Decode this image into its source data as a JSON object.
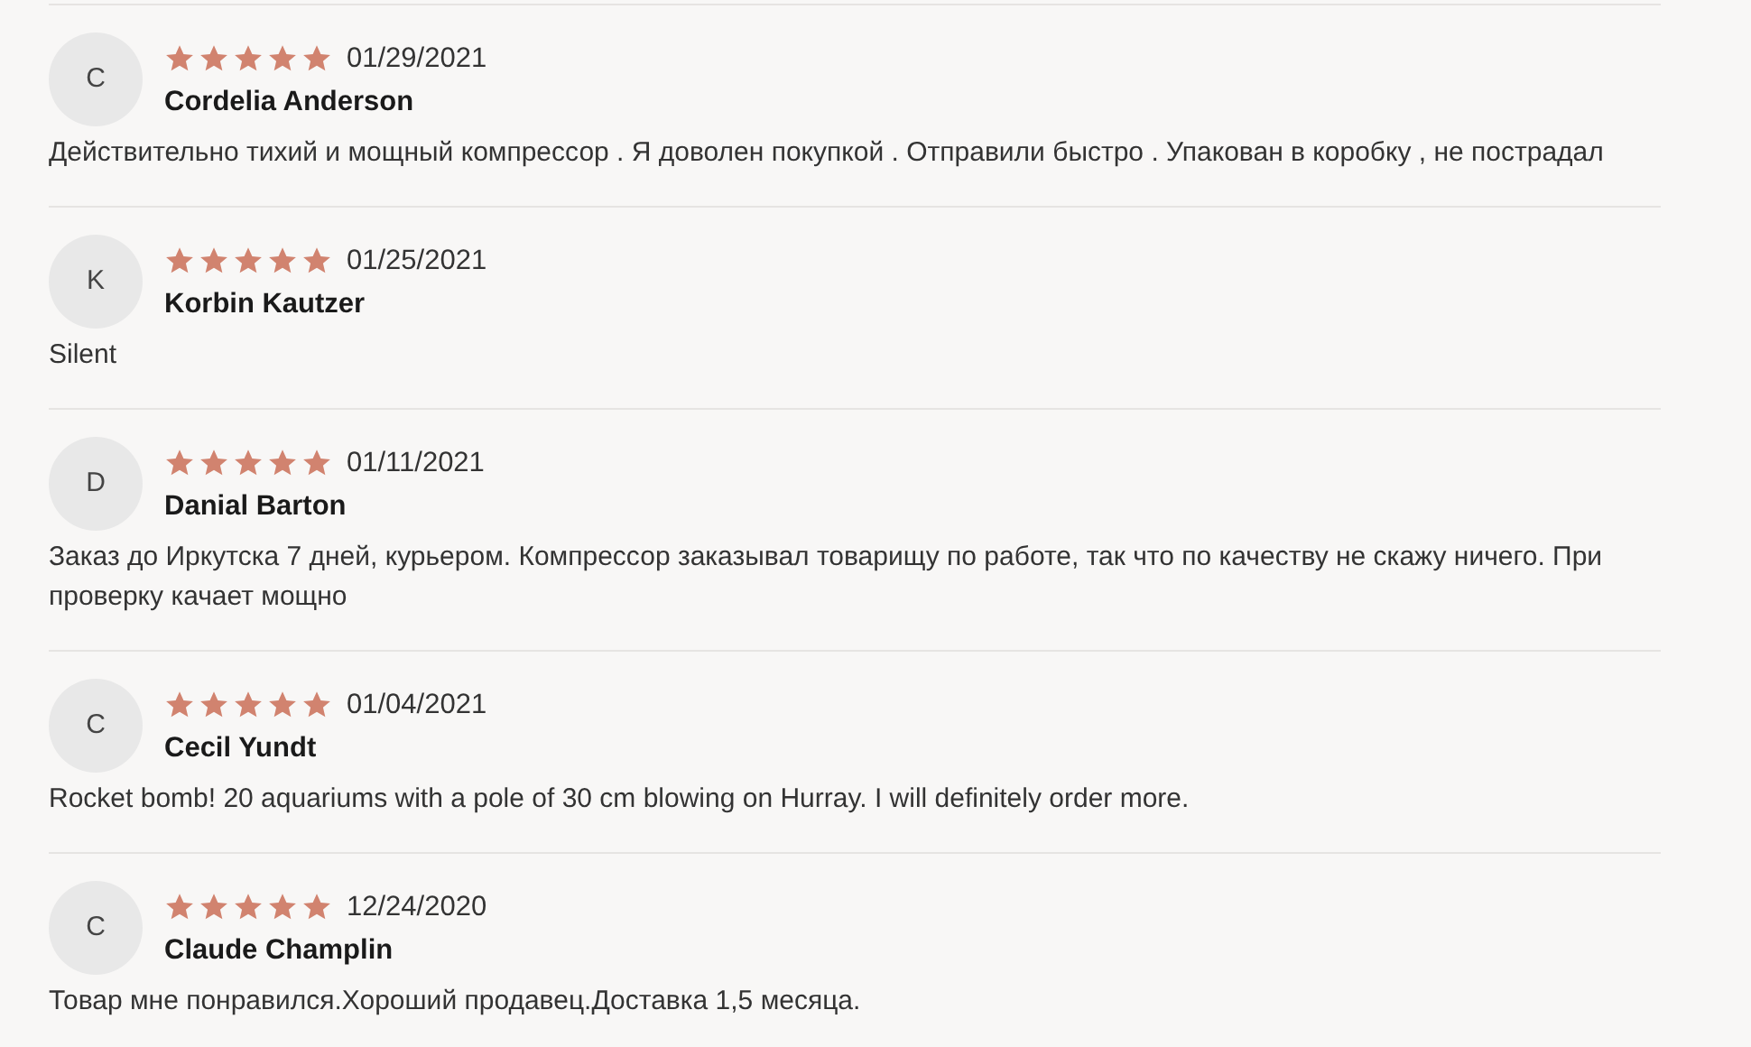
{
  "reviews": [
    {
      "avatar": "C",
      "stars": 5,
      "date": "01/29/2021",
      "name": "Cordelia Anderson",
      "text": "Действительно тихий и мощный компрессор . Я доволен покупкой . Отправили быстро . Упакован в коробку , не пострадал"
    },
    {
      "avatar": "K",
      "stars": 5,
      "date": "01/25/2021",
      "name": "Korbin Kautzer",
      "text": "Silent"
    },
    {
      "avatar": "D",
      "stars": 5,
      "date": "01/11/2021",
      "name": "Danial Barton",
      "text": "Заказ до Иркутска 7 дней, курьером. Компрессор заказывал товарищу по работе, так что по качеству не скажу ничего. При проверку качает мощно"
    },
    {
      "avatar": "C",
      "stars": 5,
      "date": "01/04/2021",
      "name": "Cecil Yundt",
      "text": "Rocket bomb! 20 aquariums with a pole of 30 cm blowing on Hurray. I will definitely order more."
    },
    {
      "avatar": "C",
      "stars": 5,
      "date": "12/24/2020",
      "name": "Claude Champlin",
      "text": "Товар мне понравился.Хороший продавец.Доставка 1,5 месяца."
    }
  ]
}
